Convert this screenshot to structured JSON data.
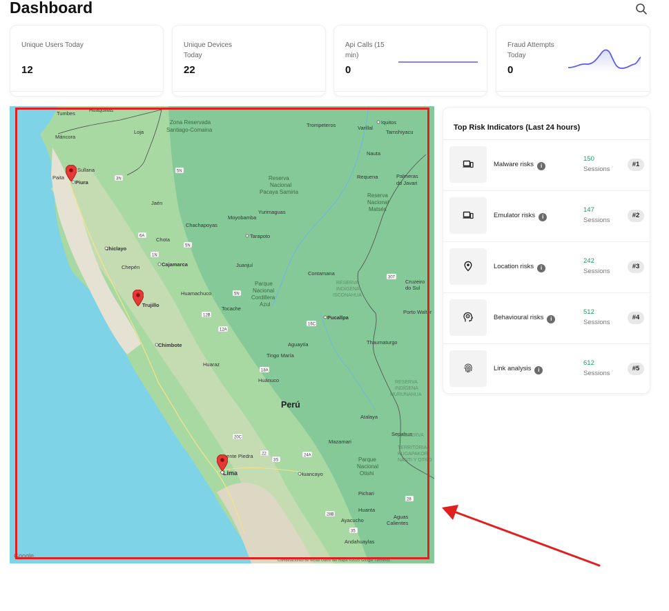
{
  "page": {
    "title": "Dashboard"
  },
  "header": {
    "search_icon": "search-icon"
  },
  "stats": [
    {
      "label": "Unique Users Today",
      "value": "12"
    },
    {
      "label": "Unique Devices Today",
      "value": "22"
    },
    {
      "label": "Api Calls (15 min)",
      "value": "0"
    },
    {
      "label": "Fraud Attempts Today",
      "value": "0"
    }
  ],
  "map": {
    "country": "Perú",
    "attribution": "Google",
    "footer": "Combinaciones de teclas   Datos del mapa ©2025 Google   Términos",
    "markers": [
      "Piura",
      "Trujillo",
      "Lima"
    ],
    "labels": {
      "tumbes": "Tumbes",
      "huaquillas": "Huaquillas",
      "loja": "Loja",
      "mancora": "Máncora",
      "zona1": "Zona Reservada",
      "zona2": "Santiago-Comaina",
      "trompeteros": "Trompeteros",
      "iquitos": "Iquitos",
      "varillal": "Varillal",
      "tamshiyacu": "Tamshiyacu",
      "nauta": "Nauta",
      "requena": "Requena",
      "palmeras1": "Palmeras",
      "palmeras2": "do Javari",
      "paita": "Paita",
      "sullana": "Sullana",
      "piura": "Piura",
      "pacaya1": "Reserva",
      "pacaya2": "Nacional",
      "pacaya3": "Pacaya Samiria",
      "jaen": "Jaén",
      "yurimaguas": "Yurimaguas",
      "matses1": "Reserva",
      "matses2": "Nacional",
      "matses3": "Matsés",
      "chachapoyas": "Chachapoyas",
      "moyobamba": "Moyobamba",
      "chota": "Chota",
      "tarapoto": "Tarapoto",
      "chiclayo": "Chiclayo",
      "juanjui": "Juanjuí",
      "chepen": "Chepén",
      "cajamarca": "Cajamarca",
      "contamana": "Contamana",
      "cruzeiro1": "Cruzeiro",
      "cruzeiro2": "do Sul",
      "azul1": "Parque",
      "azul2": "Nacional",
      "azul3": "Cordillera",
      "azul4": "Azul",
      "isconahua1": "RESERVA",
      "isconahua2": "INDÍGENA",
      "isconahua3": "ISCONAHUA",
      "huamachuco": "Huamachuco",
      "trujillo": "Trujillo",
      "tocache": "Tocache",
      "pucallpa": "Pucallpa",
      "portowalter1": "Porto Walter",
      "chimbote": "Chimbote",
      "aguaytia": "Aguaytía",
      "thaumaturgo": "Thaumaturgo",
      "tingomaria": "Tingo María",
      "huaraz": "Huaraz",
      "huanuco": "Huánuco",
      "murunahua1": "RESERVA",
      "murunahua2": "INDÍGENA",
      "murunahua3": "MURUNAHUA",
      "atalaya": "Atalaya",
      "sepahua": "Sepahua",
      "mazamari": "Mazamari",
      "kugapakori1": "RESERVA",
      "kugapakori2": "TERRITORIAL",
      "kugapakori3": "KUGAPAKORI",
      "kugapakori4": "NANTI Y OTRO",
      "puentepiedra": "Puente Piedra",
      "lima": "Lima",
      "huancayo": "Huancayo",
      "otishi1": "Parque",
      "otishi2": "Nacional",
      "otishi3": "Otishi",
      "pichari": "Pichari",
      "huanta": "Huanta",
      "ayacucho": "Ayacucho",
      "aguas1": "Aguas",
      "aguas2": "Calientes",
      "andahuaylas": "Andahuaylas"
    },
    "routes": [
      "1N",
      "3N",
      "5N",
      "6A",
      "12B",
      "12A",
      "16C",
      "18A",
      "20C",
      "22",
      "24A",
      "28",
      "28B",
      "35",
      "307",
      "3S"
    ]
  },
  "risk": {
    "title": "Top Risk Indicators (Last 24 hours)",
    "info_glyph": "i",
    "items": [
      {
        "name": "Malware risks",
        "count": "150",
        "unit": "Sessions",
        "rank": "#1",
        "icon": "laptop-phone-icon"
      },
      {
        "name": "Emulator risks",
        "count": "147",
        "unit": "Sessions",
        "rank": "#2",
        "icon": "laptop-phone-icon"
      },
      {
        "name": "Location risks",
        "count": "242",
        "unit": "Sessions",
        "rank": "#3",
        "icon": "location-pin-icon"
      },
      {
        "name": "Behavioural risks",
        "count": "512",
        "unit": "Sessions",
        "rank": "#4",
        "icon": "head-brain-icon"
      },
      {
        "name": "Link analysis",
        "count": "612",
        "unit": "Sessions",
        "rank": "#5",
        "icon": "fingerprint-icon"
      }
    ]
  },
  "colors": {
    "accent": "#5b5ce6",
    "highlight": "#e02020",
    "positive": "#1aa05a"
  }
}
